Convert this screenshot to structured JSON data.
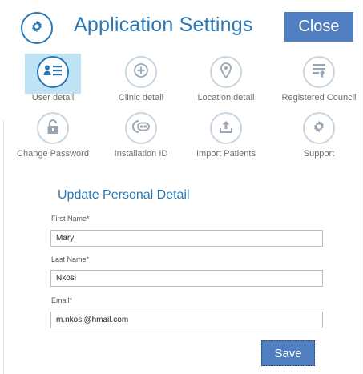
{
  "header": {
    "title": "Application Settings",
    "close_label": "Close",
    "logo_icon": "gear-icon"
  },
  "tiles": [
    {
      "label": "User detail",
      "icon": "user-card-icon",
      "active": true
    },
    {
      "label": "Clinic detail",
      "icon": "plus-circle-icon",
      "active": false
    },
    {
      "label": "Location detail",
      "icon": "map-pin-icon",
      "active": false
    },
    {
      "label": "Registered Council",
      "icon": "certificate-icon",
      "active": false
    },
    {
      "label": "Change Password",
      "icon": "lock-icon",
      "active": false
    },
    {
      "label": "Installation ID",
      "icon": "id-badge-icon",
      "active": false
    },
    {
      "label": "Import Patients",
      "icon": "upload-icon",
      "active": false
    },
    {
      "label": "Support",
      "icon": "gear-icon",
      "active": false
    }
  ],
  "form": {
    "heading": "Update Personal Detail",
    "first_name_label": "First Name*",
    "first_name_value": "Mary",
    "last_name_label": "Last Name*",
    "last_name_value": "Nkosi",
    "email_label": "Email*",
    "email_value": "m.nkosi@hmail.com",
    "save_label": "Save"
  },
  "colors": {
    "accent": "#2b78b5",
    "button": "#4f7fc0",
    "active_tile_bg": "#bde3f5",
    "icon_muted": "#9aa7b2"
  }
}
